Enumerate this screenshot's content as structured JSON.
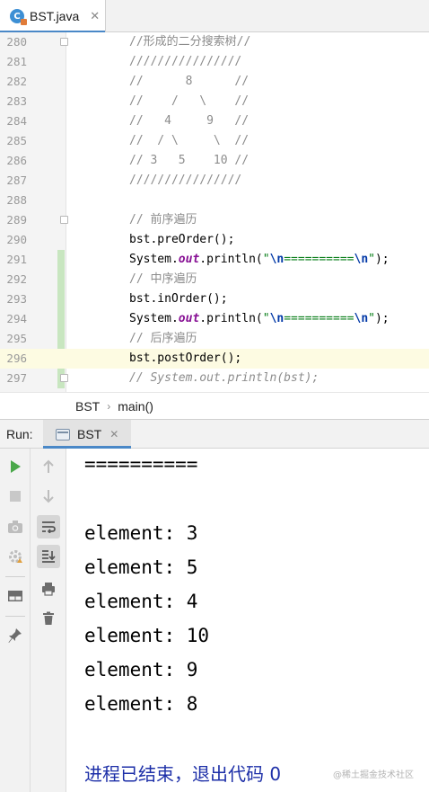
{
  "editor_tab": {
    "title": "BST.java",
    "close_glyph": "✕",
    "icon": "java-class-icon"
  },
  "code_lines": [
    {
      "num": "280",
      "text": "//形成的二分搜索树//",
      "style": "cmt"
    },
    {
      "num": "281",
      "text": "////////////////",
      "style": "cmt"
    },
    {
      "num": "282",
      "text": "//      8      //",
      "style": "cmt"
    },
    {
      "num": "283",
      "text": "//    /   \\    //",
      "style": "cmt"
    },
    {
      "num": "284",
      "text": "//   4     9   //",
      "style": "cmt"
    },
    {
      "num": "285",
      "text": "//  / \\     \\  //",
      "style": "cmt"
    },
    {
      "num": "286",
      "text": "// 3   5    10 //",
      "style": "cmt"
    },
    {
      "num": "287",
      "text": "////////////////",
      "style": "cmt"
    },
    {
      "num": "288",
      "text": "",
      "style": "plain"
    },
    {
      "num": "289",
      "text": "// 前序遍历",
      "style": "cmt"
    },
    {
      "num": "290",
      "text": "bst.preOrder();",
      "style": "plain"
    },
    {
      "num": "291",
      "prefix": "System.",
      "field": "out",
      "mid": ".println(",
      "q1": "\"",
      "esc1": "\\n",
      "body": "==========",
      "esc2": "\\n",
      "q2": "\"",
      "suffix": ");",
      "style": "println"
    },
    {
      "num": "292",
      "text": "// 中序遍历",
      "style": "cmt"
    },
    {
      "num": "293",
      "text": "bst.inOrder();",
      "style": "plain"
    },
    {
      "num": "294",
      "prefix": "System.",
      "field": "out",
      "mid": ".println(",
      "q1": "\"",
      "esc1": "\\n",
      "body": "==========",
      "esc2": "\\n",
      "q2": "\"",
      "suffix": ");",
      "style": "println"
    },
    {
      "num": "295",
      "text": "// 后序遍历",
      "style": "cmt"
    },
    {
      "num": "296",
      "text": "bst.postOrder();",
      "style": "plain"
    },
    {
      "num": "297",
      "text": "// System.out.println(bst);",
      "style": "cmt-i"
    }
  ],
  "breadcrumb": {
    "class_name": "BST",
    "separator": "›",
    "method": "main()"
  },
  "run_panel": {
    "label": "Run:",
    "tab_title": "BST",
    "tab_close": "✕"
  },
  "toolbar_left_icons": [
    "rerun-icon",
    "stop-icon",
    "camera-icon",
    "settings-icon",
    "layout-icon",
    "pin-icon"
  ],
  "toolbar_right_icons": [
    "arrow-up-icon",
    "arrow-down-icon",
    "soft-wrap-icon",
    "scroll-to-end-icon",
    "print-icon",
    "trash-icon"
  ],
  "console_output": {
    "separator": "==========",
    "lines": [
      "element: 3",
      "element: 5",
      "element: 4",
      "element: 10",
      "element: 9",
      "element: 8"
    ],
    "exit_message": "进程已结束，退出代码 0",
    "watermark": "@稀土掘金技术社区"
  },
  "colors": {
    "comment": "#8c8c8c",
    "string": "#067d17",
    "escape": "#0037a6",
    "static_field": "#871094",
    "exit_text": "#1d2fa8",
    "run_icon": "#4aa84a",
    "tab_underline": "#4a88c7",
    "current_line": "#fdfbe2",
    "change_marker": "#c8e6c0"
  }
}
